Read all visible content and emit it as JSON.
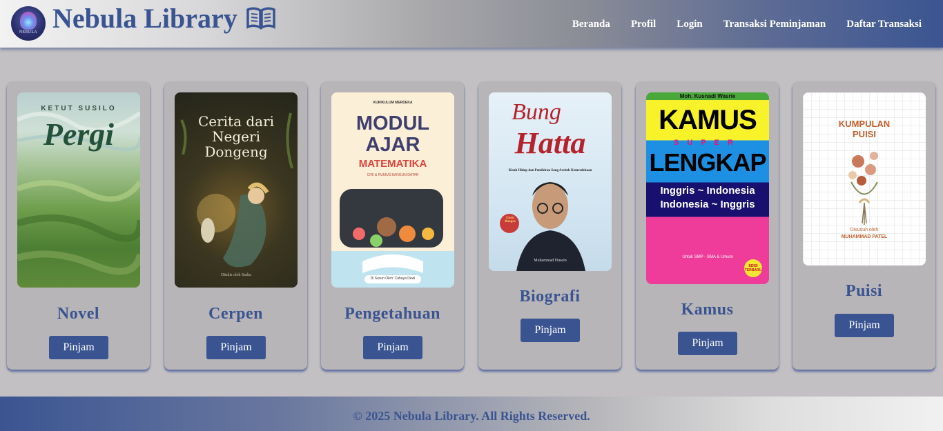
{
  "header": {
    "brand": "Nebula Library",
    "logo_text": "NEBULA",
    "nav": [
      "Beranda",
      "Profil",
      "Login",
      "Transaksi Peminjaman",
      "Daftar Transaksi"
    ]
  },
  "books": [
    {
      "category": "Novel",
      "button": "Pinjam",
      "cover_author": "KETUT SUSILO",
      "cover_title": "Pergi"
    },
    {
      "category": "Cerpen",
      "button": "Pinjam",
      "cover_title_1": "Cerita dari",
      "cover_title_2": "Negeri",
      "cover_title_3": "Dongeng",
      "cover_author": "Ditulis oleh Sasha"
    },
    {
      "category": "Pengetahuan",
      "button": "Pinjam",
      "cover_top": "KURIKULUM MERDEKA",
      "cover_title_1": "MODUL",
      "cover_title_2": "AJAR",
      "cover_title_3": "MATEMATIKA",
      "cover_subtitle": "CIRI & RUMUS BANGUN DATAR",
      "cover_author": "Di Susun Oleh: Cahaya Dewi"
    },
    {
      "category": "Biografi",
      "button": "Pinjam",
      "cover_title_1": "Bung",
      "cover_title_2": "Hatta",
      "cover_subtitle": "Kisah Hidup dan Pemikiran Sang Arsitek Kemerdekaan",
      "cover_badge": "Guru Bangsa",
      "cover_author": "Muhammad Husein"
    },
    {
      "category": "Kamus",
      "button": "Pinjam",
      "cover_author": "Moh. Kusnadi Wasrie",
      "cover_title_1": "KAMUS",
      "cover_title_2": "SUPER",
      "cover_title_3": "LENGKAP",
      "cover_line_1": "Inggris ~ Indonesia",
      "cover_line_2": "Indonesia ~ Inggris",
      "cover_level": "Untuk SMP - SMA & Umum",
      "cover_badge": "EDISI TERBARU"
    },
    {
      "category": "Puisi",
      "button": "Pinjam",
      "cover_title_1": "KUMPULAN",
      "cover_title_2": "PUISI",
      "cover_by": "Disusun oleh",
      "cover_author": "MUHAMMAD PATEL"
    }
  ],
  "footer": {
    "text": "© 2025 Nebula Library. All Rights Reserved."
  },
  "colors": {
    "primary": "#3a5491",
    "background": "#c2c0c2",
    "card": "#b7b5b8"
  }
}
